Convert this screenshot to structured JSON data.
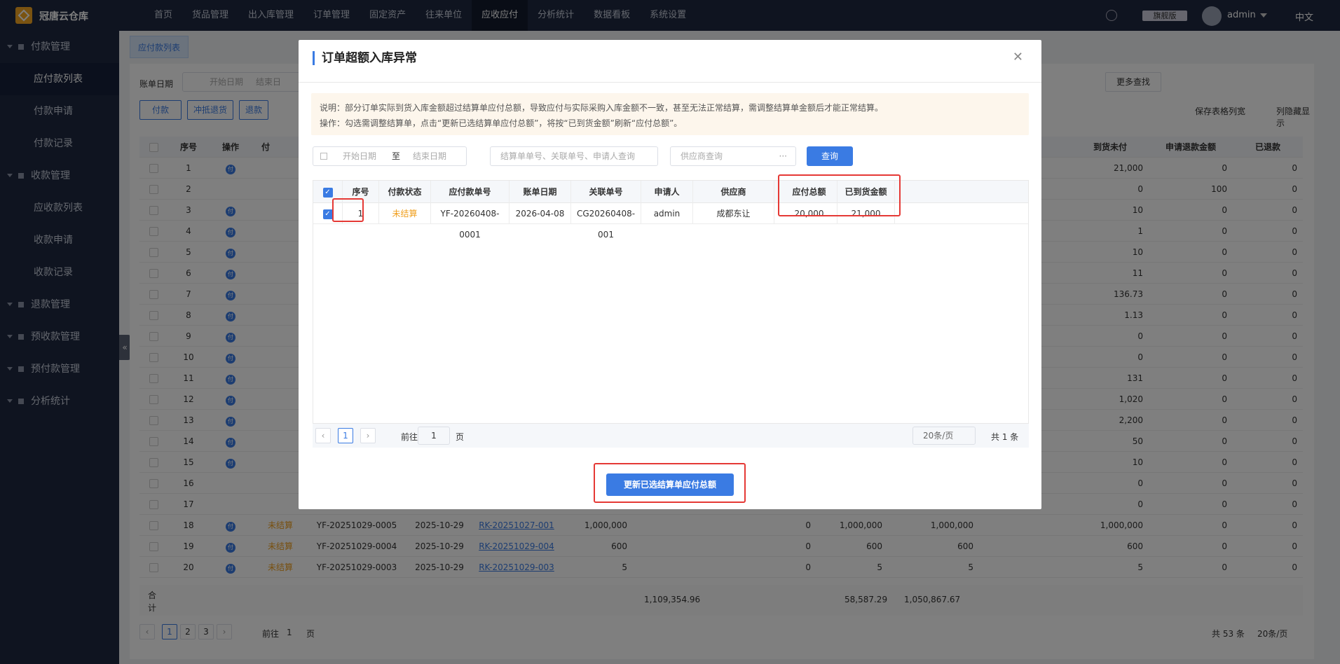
{
  "app": {
    "title": "冠唐云仓库"
  },
  "nav": [
    "首页",
    "货品管理",
    "出入库管理",
    "订单管理",
    "固定资产",
    "往来单位",
    "应收应付",
    "分析统计",
    "数据看板",
    "系统设置"
  ],
  "header": {
    "edition": "旗舰版",
    "user": "admin",
    "lang": "中文"
  },
  "sidebar": [
    {
      "label": "付款管理",
      "type": "group"
    },
    {
      "label": "应付款列表",
      "type": "sub",
      "active": true
    },
    {
      "label": "付款申请",
      "type": "sub2"
    },
    {
      "label": "付款记录",
      "type": "sub"
    },
    {
      "label": "收款管理",
      "type": "group"
    },
    {
      "label": "应收款列表",
      "type": "sub"
    },
    {
      "label": "收款申请",
      "type": "sub"
    },
    {
      "label": "收款记录",
      "type": "sub"
    },
    {
      "label": "退款管理",
      "type": "group"
    },
    {
      "label": "预收款管理",
      "type": "group"
    },
    {
      "label": "预付款管理",
      "type": "group"
    },
    {
      "label": "分析统计",
      "type": "group"
    }
  ],
  "page": {
    "tab": "应付款列表",
    "date_label": "账单日期",
    "start_date": "开始日期",
    "end_date": "结束日",
    "more": "更多查找",
    "actions": [
      "付款",
      "冲抵退货",
      "退款"
    ],
    "save_cols": "保存表格列宽",
    "hide_cols": "列隐藏显示",
    "headers": {
      "idx": "序号",
      "op": "操作",
      "pay_type": "付",
      "due": "到货未付",
      "refund_req": "申请退款金额",
      "refunded": "已退款"
    },
    "rows": [
      {
        "idx": "1",
        "due": "21,000",
        "req": "0",
        "ref": "0"
      },
      {
        "idx": "2",
        "due": "0",
        "req": "100",
        "ref": "0"
      },
      {
        "idx": "3",
        "due": "10",
        "req": "0",
        "ref": "0"
      },
      {
        "idx": "4",
        "due": "1",
        "req": "0",
        "ref": "0"
      },
      {
        "idx": "5",
        "due": "10",
        "req": "0",
        "ref": "0"
      },
      {
        "idx": "6",
        "due": "11",
        "req": "0",
        "ref": "0"
      },
      {
        "idx": "7",
        "due": "136.73",
        "req": "0",
        "ref": "0"
      },
      {
        "idx": "8",
        "due": "1.13",
        "req": "0",
        "ref": "0"
      },
      {
        "idx": "9",
        "due": "0",
        "req": "0",
        "ref": "0"
      },
      {
        "idx": "10",
        "due": "0",
        "req": "0",
        "ref": "0"
      },
      {
        "idx": "11",
        "due": "131",
        "req": "0",
        "ref": "0"
      },
      {
        "idx": "12",
        "due": "1,020",
        "req": "0",
        "ref": "0"
      },
      {
        "idx": "13",
        "due": "2,200",
        "req": "0",
        "ref": "0"
      },
      {
        "idx": "14",
        "due": "50",
        "req": "0",
        "ref": "0"
      },
      {
        "idx": "15",
        "due": "10",
        "req": "0",
        "ref": "0"
      },
      {
        "idx": "16",
        "due": "0",
        "req": "0",
        "ref": "0"
      },
      {
        "idx": "17",
        "due": "0",
        "req": "0",
        "ref": "0"
      }
    ],
    "visible_rows": [
      {
        "idx": "18",
        "status": "未结算",
        "no": "YF-20251029-0005",
        "date": "2025-10-29",
        "link": "RK-20251027-001",
        "amt": "1,000,000",
        "c1": "0",
        "c2": "1,000,000",
        "c3": "1,000,000",
        "due": "1,000,000",
        "req": "0",
        "ref": "0"
      },
      {
        "idx": "19",
        "status": "未结算",
        "no": "YF-20251029-0004",
        "date": "2025-10-29",
        "link": "RK-20251029-004",
        "amt": "600",
        "c1": "0",
        "c2": "600",
        "c3": "600",
        "due": "600",
        "req": "0",
        "ref": "0"
      },
      {
        "idx": "20",
        "status": "未结算",
        "no": "YF-20251029-0003",
        "date": "2025-10-29",
        "link": "RK-20251029-003",
        "amt": "5",
        "c1": "0",
        "c2": "5",
        "c3": "5",
        "due": "5",
        "req": "0",
        "ref": "0"
      }
    ],
    "total": {
      "label1": "合",
      "label2": "计",
      "amt": "1,109,354.96",
      "c1": "58,587.29",
      "c2": "1,050,867.67"
    },
    "pager": {
      "pages": [
        "1",
        "2",
        "3"
      ],
      "goto": "前往",
      "page": "1",
      "page_unit": "页",
      "total": "共 53 条",
      "size": "20条/页"
    }
  },
  "modal": {
    "title": "订单超额入库异常",
    "notice_line1": "说明：部分订单实际到货入库金额超过结算单应付总额，导致应付与实际采购入库金额不一致，甚至无法正常结算，需调整结算单金额后才能正常结算。",
    "notice_line2": "操作：勾选需调整结算单，点击“更新已选结算单应付总额”，将按“已到货金额”刷新“应付总额”。",
    "start_date": "开始日期",
    "to": "至",
    "end_date": "结束日期",
    "search_placeholder": "结算单单号、关联单号、申请人查询",
    "supplier_placeholder": "供应商查询",
    "query": "查询",
    "headers": [
      "序号",
      "付款状态",
      "应付款单号",
      "账单日期",
      "关联单号",
      "申请人",
      "供应商",
      "应付总额",
      "已到货金额"
    ],
    "rows": [
      {
        "idx": "1",
        "status": "未结算",
        "no": "YF-20260408-0001",
        "date": "2026-04-08",
        "link": "CG20260408-001",
        "applicant": "admin",
        "supplier": "成都东让",
        "payable": "20,000",
        "arrived": "21,000"
      }
    ],
    "pager": {
      "page": "1",
      "goto": "前往",
      "goto_val": "1",
      "unit": "页",
      "size": "20条/页",
      "total": "共 1 条"
    },
    "update_button": "更新已选结算单应付总额"
  }
}
